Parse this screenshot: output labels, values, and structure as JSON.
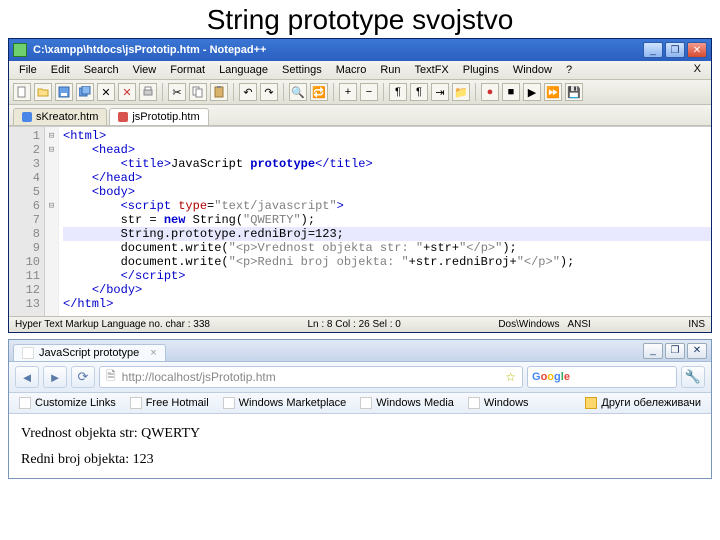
{
  "slide": {
    "title": "String prototype svojstvo"
  },
  "npp": {
    "title": "C:\\xampp\\htdocs\\jsPrototip.htm - Notepad++",
    "menu": [
      "File",
      "Edit",
      "Search",
      "View",
      "Format",
      "Language",
      "Settings",
      "Macro",
      "Run",
      "TextFX",
      "Plugins",
      "Window",
      "?"
    ],
    "tabs": [
      {
        "label": "sKreator.htm",
        "active": false
      },
      {
        "label": "jsPrototip.htm",
        "active": true
      }
    ],
    "lines": [
      "1",
      "2",
      "3",
      "4",
      "5",
      "6",
      "7",
      "8",
      "9",
      "10",
      "11",
      "12",
      "13"
    ],
    "folds": [
      "⊟",
      "⊟",
      "",
      "",
      "",
      "⊟",
      "",
      "",
      "",
      "",
      "",
      "",
      ""
    ],
    "code": [
      {
        "html": "<span class='tag'>&lt;html&gt;</span>"
      },
      {
        "html": "    <span class='tag'>&lt;head&gt;</span>"
      },
      {
        "html": "        <span class='tag'>&lt;title&gt;</span>JavaScript <span class='op'>prototype</span><span class='tag'>&lt;/title&gt;</span>"
      },
      {
        "html": "    <span class='tag'>&lt;/head&gt;</span>"
      },
      {
        "html": "    <span class='tag'>&lt;body&gt;</span>"
      },
      {
        "html": "        <span class='tag'>&lt;script</span> <span class='attr'>type</span>=<span class='str'>\"text/javascript\"</span><span class='tag'>&gt;</span>"
      },
      {
        "html": "        str = <span class='op'>new</span> String(<span class='str'>\"QWERTY\"</span>);"
      },
      {
        "html": "        String.prototype.redniBroj=123;",
        "hl": true
      },
      {
        "html": "        document.write(<span class='str'>\"&lt;p&gt;Vrednost objekta str: \"</span>+str+<span class='str'>\"&lt;/p&gt;\"</span>);"
      },
      {
        "html": "        document.write(<span class='str'>\"&lt;p&gt;Redni broj objekta: \"</span>+str.redniBroj+<span class='str'>\"&lt;/p&gt;\"</span>);"
      },
      {
        "html": "        <span class='tag'>&lt;/script&gt;</span>"
      },
      {
        "html": "    <span class='tag'>&lt;/body&gt;</span>"
      },
      {
        "html": "<span class='tag'>&lt;/html&gt;</span>"
      }
    ],
    "status": {
      "lang": "Hyper Text Markup Language   no. char : 338",
      "pos": "Ln : 8    Col : 26    Sel : 0",
      "eol": "Dos\\Windows",
      "enc": "ANSI",
      "mode": "INS"
    }
  },
  "browser": {
    "tab_title": "JavaScript prototype",
    "url": "http://localhost/jsPrototip.htm",
    "search_engine": "Google",
    "bookmarks": [
      "Customize Links",
      "Free Hotmail",
      "Windows Marketplace",
      "Windows Media",
      "Windows"
    ],
    "bookmark_folder": "Други обележивачи",
    "page": {
      "line1": "Vrednost objekta str: QWERTY",
      "line2": "Redni broj objekta: 123"
    }
  }
}
